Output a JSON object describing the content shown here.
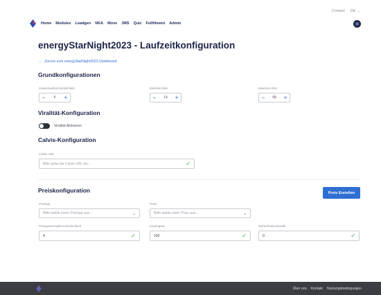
{
  "topbar": {
    "contact": "Contact",
    "language": "DE"
  },
  "nav": {
    "items": [
      "Home",
      "Modules",
      "Leadgen",
      "NKA",
      "Move",
      "JMS",
      "Quiz",
      "Fulfillment",
      "Admin"
    ]
  },
  "page": {
    "title": "energyStarNight2023 - Laufzeitkonfiguration",
    "back_link": "Zurück zum energyStarNight2023 Dashboard"
  },
  "grund": {
    "heading": "Grundkonfigurationen",
    "fields": [
      {
        "label": "Gewinnwahrscheinlichkeit",
        "value": "5"
      },
      {
        "label": "Minimal-Alter",
        "value": "14"
      },
      {
        "label": "Maximal-Alter",
        "value": "99"
      }
    ]
  },
  "viral": {
    "heading": "Viralität-Konfiguration",
    "toggle_label": "Viralität Aktivieren"
  },
  "calvis": {
    "heading": "Calvis-Konfiguration",
    "url_label": "Calvis URL",
    "url_placeholder": "Bitte gebe die Calvis URL ein..."
  },
  "preis": {
    "heading": "Preiskonfiguration",
    "create_button": "Preis Erstellen",
    "preistyp_label": "Preistyp",
    "preistyp_placeholder": "Bitte wähle einen Preistyp aus...",
    "preis_label": "Preis",
    "preis_placeholder": "Bitte wähle einen Preis aus...",
    "win_label": "Preisgewinnwahrscheinlichkeit",
    "win_value": "4",
    "kontingent_label": "Kontingent",
    "kontingent_value": "100",
    "sicherheit_label": "Sicherheitsschwelle",
    "sicherheit_value": "0"
  },
  "footer": {
    "links": [
      "Über uns",
      "Kontakt",
      "Nutzungsbedingungen"
    ]
  }
}
